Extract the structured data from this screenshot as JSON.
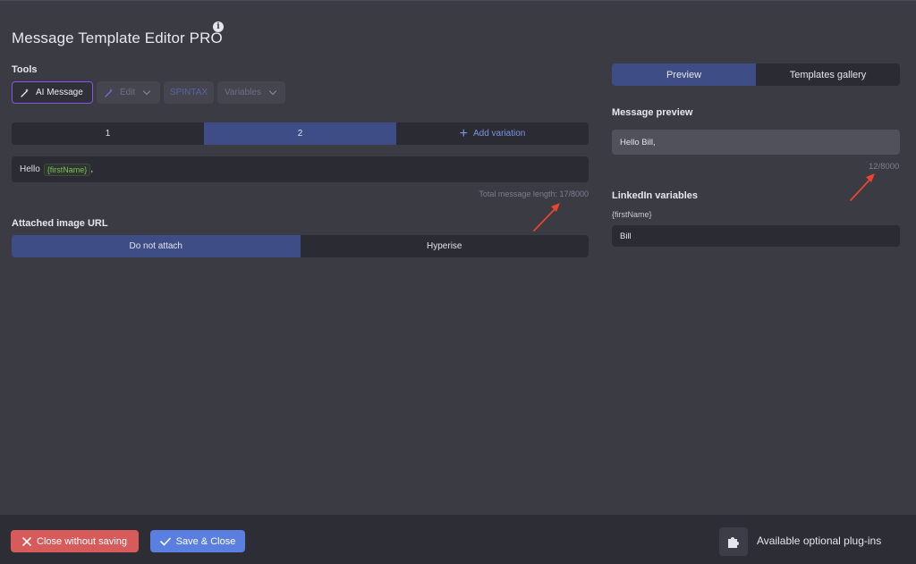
{
  "header": {
    "title": "Message Template Editor PRO",
    "info_icon": "info-icon"
  },
  "tools": {
    "label": "Tools",
    "ai_message": "AI Message",
    "edit": "Edit",
    "spintax": "SPINTAX",
    "variables": "Variables"
  },
  "variations": {
    "tabs": [
      "1",
      "2"
    ],
    "selected": "2",
    "add_label": "Add variation"
  },
  "message": {
    "prefix": "Hello",
    "variable": "{firstName}",
    "suffix": ",",
    "length_text": "Total message length: 17/8000"
  },
  "attach": {
    "label": "Attached image URL",
    "options": [
      "Do not attach",
      "Hyperise"
    ],
    "selected": "Do not attach"
  },
  "right": {
    "tabs": [
      "Preview",
      "Templates gallery"
    ],
    "selected_tab": "Preview",
    "preview_label": "Message preview",
    "preview_text": "Hello Bill,",
    "preview_count": "12/8000",
    "linkedin_label": "LinkedIn variables",
    "var_name": "{firstName}",
    "var_value": "Bill"
  },
  "footer": {
    "close_label": "Close without saving",
    "save_label": "Save & Close",
    "plugins_label": "Available optional plug-ins"
  },
  "colors": {
    "background": "#3a3b43",
    "accent_blue": "#3f4d86",
    "ai_border": "#8a54e6",
    "danger": "#d75b5b",
    "primary": "#5a7fe0",
    "annotation_arrow": "#e8452f"
  }
}
